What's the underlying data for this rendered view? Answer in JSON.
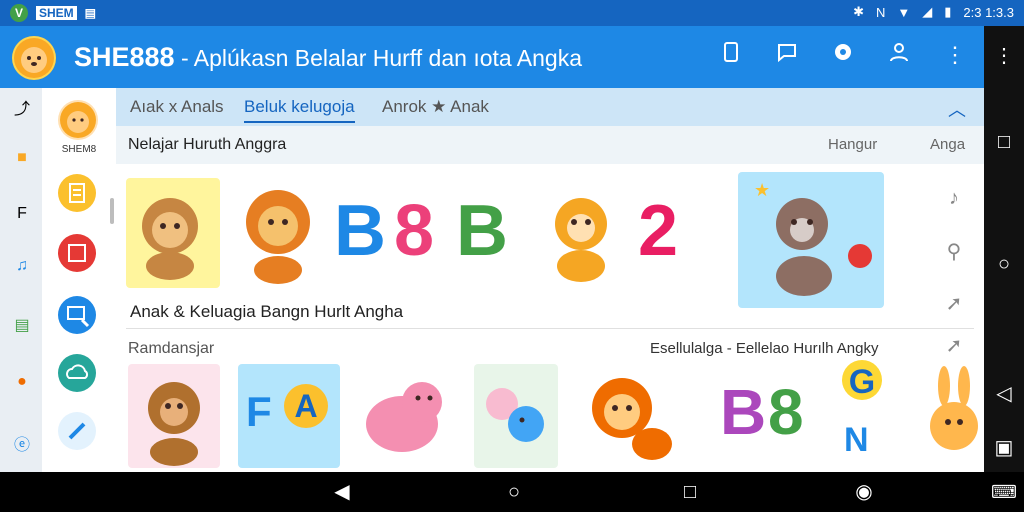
{
  "status_bar": {
    "left_items": [
      "V",
      "SHEM",
      "▤"
    ],
    "time": "2:3 1:3.3"
  },
  "app_bar": {
    "brand": "SHE888",
    "subtitle": "- Aplúkasn Belalar Hurff dan ıota Angka",
    "actions": [
      "tablet-icon",
      "chat-bubble-icon",
      "gear-icon",
      "person-icon",
      "more-vertical-icon"
    ]
  },
  "drawer": {
    "user_label": "SHEM8",
    "items": [
      "book-icon",
      "calendar-icon",
      "search-icon",
      "cloud-icon",
      "pencil-icon"
    ]
  },
  "tabs": [
    {
      "label": "Aıak x Anals",
      "active": false
    },
    {
      "label": "Beluk kelugoja",
      "active": true
    },
    {
      "label": "Anrok ★ Anak",
      "active": false
    }
  ],
  "section1": {
    "title": "Nelajar Huruth Anggra",
    "right_items": [
      "Hangur",
      "Anga"
    ],
    "caption": "Anak & Keluagia Bangn Hurlt Angha",
    "glyphs": [
      "B",
      "8",
      "B",
      "2"
    ]
  },
  "section2": {
    "title": "Ramdansjar",
    "right_text": "Esellulalga - Eellelao Hurılh Angky",
    "glyphs": [
      "F",
      "A",
      "B",
      "8",
      "G",
      "N"
    ]
  },
  "colors": {
    "appbar": "#1e88e5",
    "statusbar": "#1565c0",
    "tabs_bg": "#cde5f7",
    "accent": "#1565c0"
  }
}
